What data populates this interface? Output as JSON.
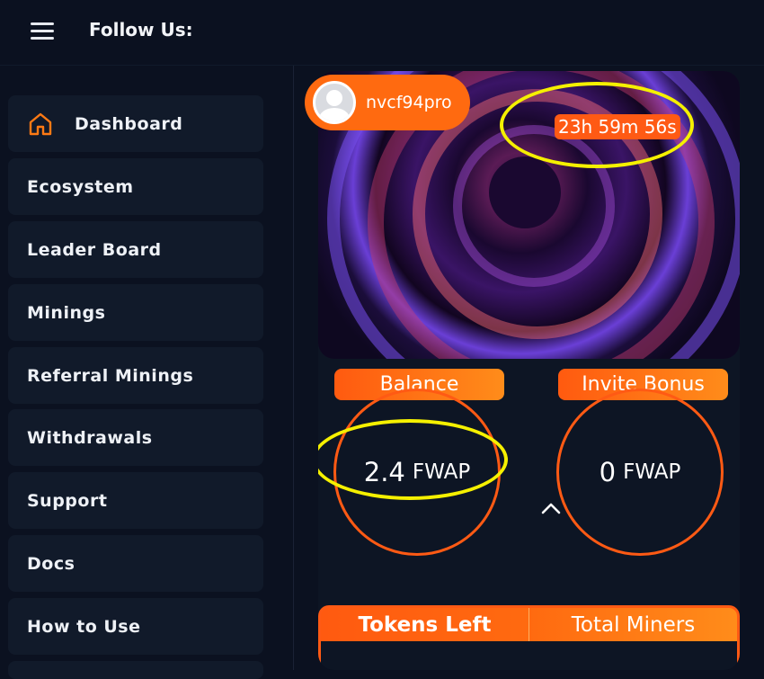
{
  "header": {
    "follow_label": "Follow Us:"
  },
  "sidebar": {
    "items": [
      {
        "label": "Dashboard",
        "icon": "home-icon"
      },
      {
        "label": "Ecosystem"
      },
      {
        "label": "Leader Board"
      },
      {
        "label": "Minings"
      },
      {
        "label": "Referral Minings"
      },
      {
        "label": "Withdrawals"
      },
      {
        "label": "Support"
      },
      {
        "label": "Docs"
      },
      {
        "label": "How to Use"
      }
    ]
  },
  "user": {
    "name": "nvcf94pro"
  },
  "timer": {
    "value": "23h 59m 56s"
  },
  "balance": {
    "label": "Balance",
    "amount": "2.4",
    "unit": "FWAP"
  },
  "invite": {
    "label": "Invite Bonus",
    "amount": "0",
    "unit": "FWAP"
  },
  "stats": {
    "tokens_left_label": "Tokens Left",
    "total_miners_label": "Total Miners"
  },
  "colors": {
    "accent": "#ff6a10",
    "highlight": "#f5f000",
    "background": "#0b1120"
  }
}
